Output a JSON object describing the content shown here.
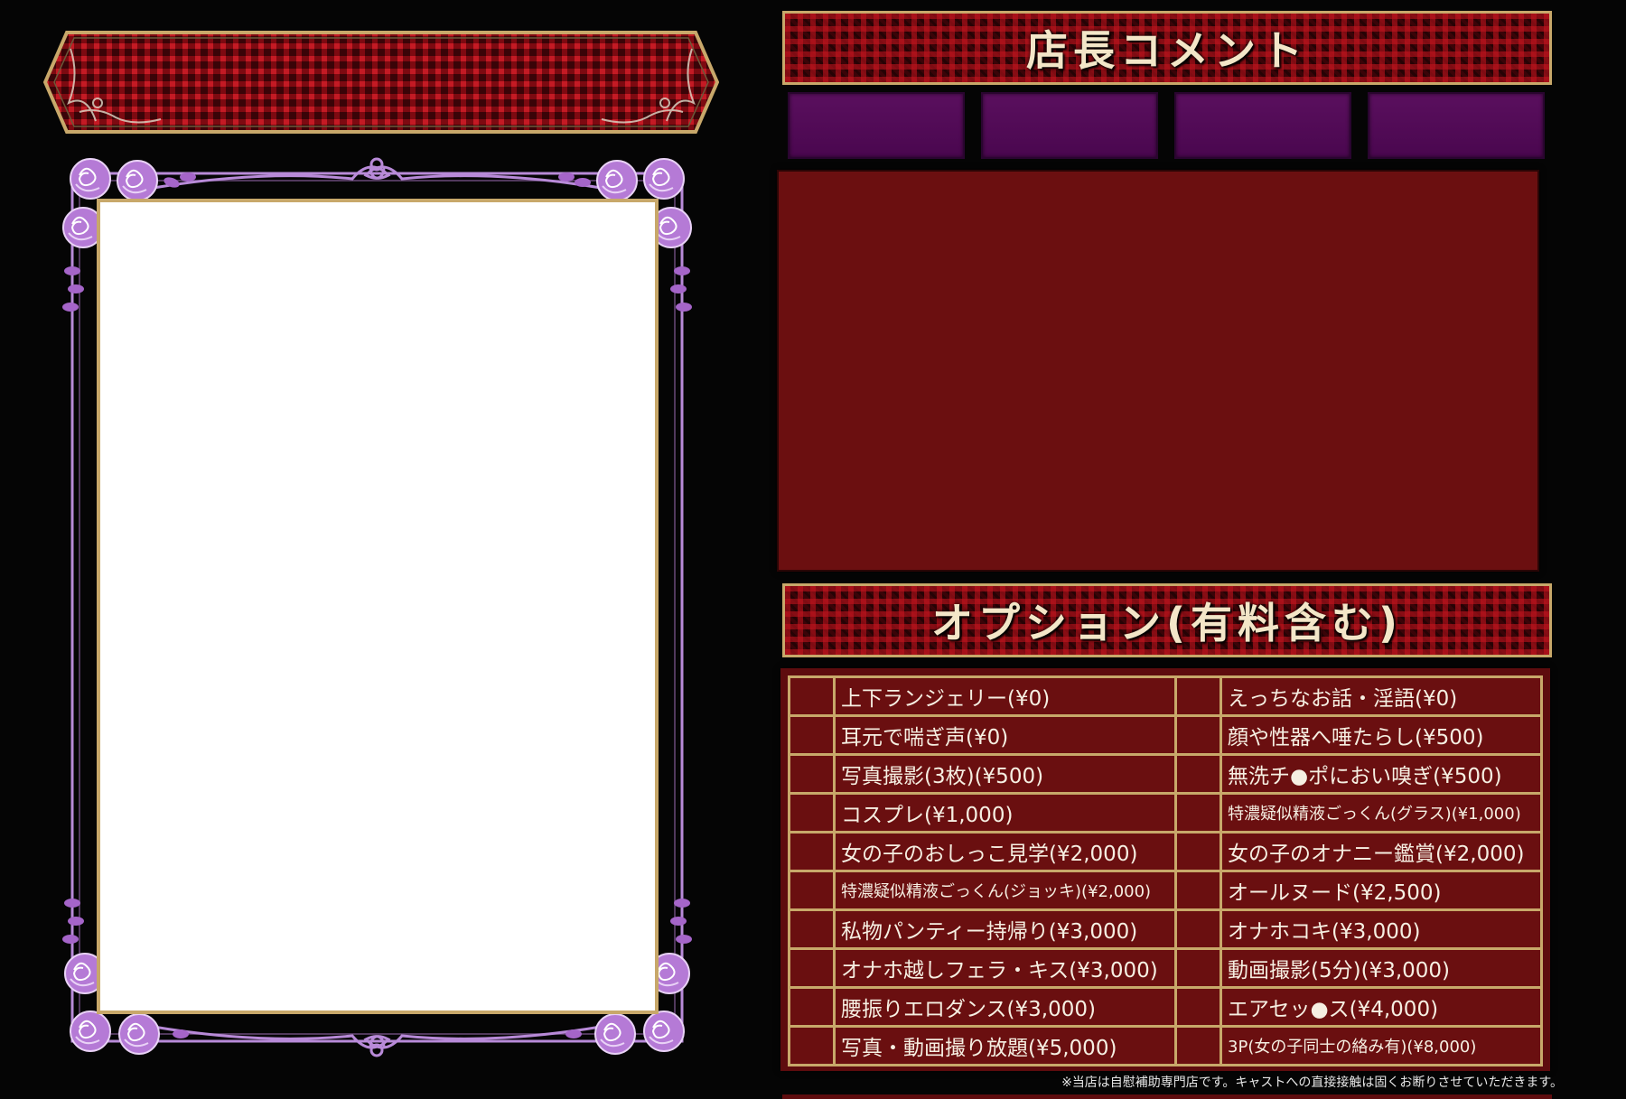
{
  "section_headers": {
    "comment": "店長コメント",
    "options": "オプション(有料含む)"
  },
  "options": {
    "rows": [
      {
        "left": "上下ランジェリー(¥0)",
        "right": "えっちなお話・淫語(¥0)"
      },
      {
        "left": "耳元で喘ぎ声(¥0)",
        "right": "顔や性器へ唾たらし(¥500)"
      },
      {
        "left": "写真撮影(3枚)(¥500)",
        "right": "無洗チ●ポにおい嗅ぎ(¥500)"
      },
      {
        "left": "コスプレ(¥1,000)",
        "right": "特濃疑似精液ごっくん(グラス)(¥1,000)"
      },
      {
        "left": "女の子のおしっこ見学(¥2,000)",
        "right": "女の子のオナニー鑑賞(¥2,000)"
      },
      {
        "left": "特濃疑似精液ごっくん(ジョッキ)(¥2,000)",
        "right": "オールヌード(¥2,500)"
      },
      {
        "left": "私物パンティー持帰り(¥3,000)",
        "right": "オナホコキ(¥3,000)"
      },
      {
        "left": "オナホ越しフェラ・キス(¥3,000)",
        "right": "動画撮影(5分)(¥3,000)"
      },
      {
        "left": "腰振りエロダンス(¥3,000)",
        "right": "エアセッ●ス(¥4,000)"
      },
      {
        "left": "写真・動画撮り放題(¥5,000)",
        "right": "3P(女の子同士の絡み有)(¥8,000)"
      }
    ]
  },
  "footnote": "※当店は自慰補助専門店です。キャストへの直接接触は固くお断りさせていただきます。",
  "colors": {
    "background": "#050505",
    "gold_border": "#c8a86a",
    "dark_red": "#6b0f10",
    "purple_tab": "#4a074f",
    "rose": "#b57ad6",
    "vine": "#b88ad8"
  },
  "icons": {
    "rose_ornament": "rose-ornament-icon",
    "swirl": "swirl-ornament-icon"
  }
}
